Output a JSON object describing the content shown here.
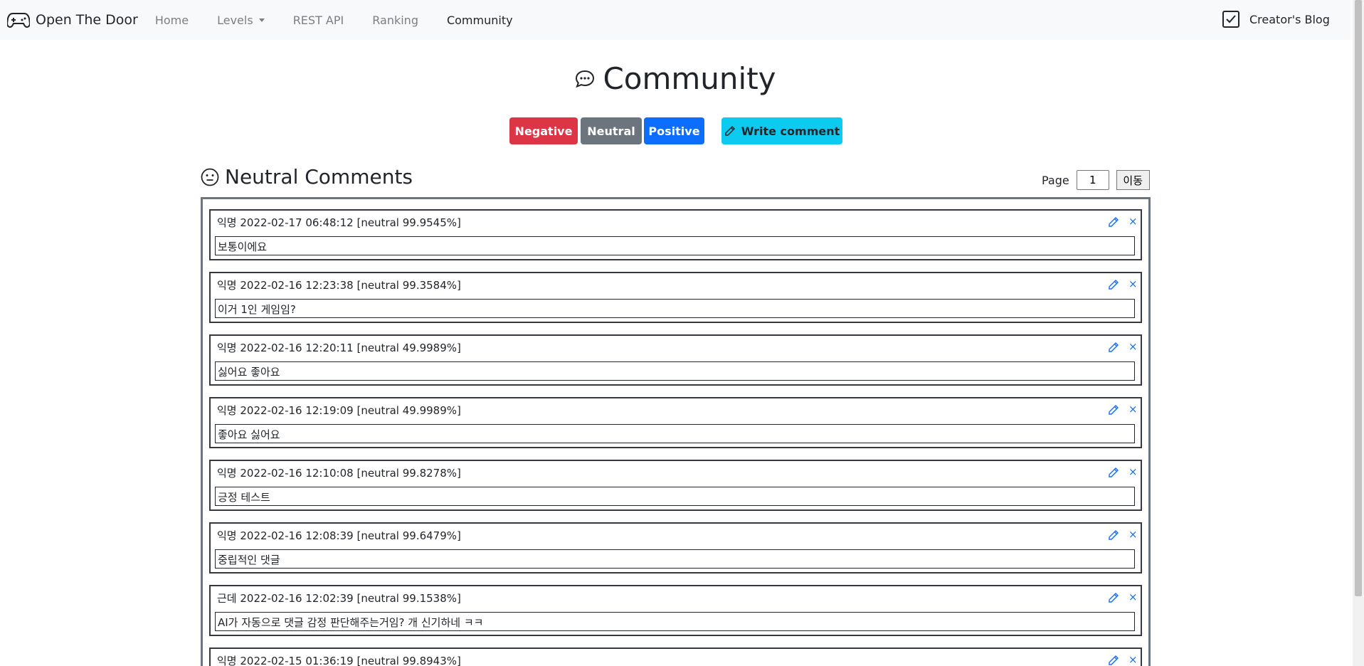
{
  "navbar": {
    "brand": "Open The Door",
    "links": [
      {
        "label": "Home",
        "active": false
      },
      {
        "label": "Levels",
        "active": false,
        "dropdown": true
      },
      {
        "label": "REST API",
        "active": false
      },
      {
        "label": "Ranking",
        "active": false
      },
      {
        "label": "Community",
        "active": true
      }
    ],
    "blog_label": "Creator's Blog"
  },
  "header": {
    "title": "Community",
    "buttons": {
      "negative": "Negative",
      "neutral": "Neutral",
      "positive": "Positive",
      "write": "Write comment"
    }
  },
  "section": {
    "title": "Neutral Comments",
    "page_label": "Page",
    "page_value": "1",
    "go_label": "이동"
  },
  "comments": [
    {
      "author": "익명",
      "stamp": "2022-02-17 06:48:12 [neutral 99.9545%]",
      "text": "보통이에요"
    },
    {
      "author": "익명",
      "stamp": "2022-02-16 12:23:38 [neutral 99.3584%]",
      "text": "이거 1인 게임임?"
    },
    {
      "author": "익명",
      "stamp": "2022-02-16 12:20:11 [neutral 49.9989%]",
      "text": "싫어요 좋아요"
    },
    {
      "author": "익명",
      "stamp": "2022-02-16 12:19:09 [neutral 49.9989%]",
      "text": "좋아요 싫어요"
    },
    {
      "author": "익명",
      "stamp": "2022-02-16 12:10:08 [neutral 99.8278%]",
      "text": "긍정 테스트"
    },
    {
      "author": "익명",
      "stamp": "2022-02-16 12:08:39 [neutral 99.6479%]",
      "text": "중립적인 댓글"
    },
    {
      "author": "근데",
      "stamp": "2022-02-16 12:02:39 [neutral 99.1538%]",
      "text": "AI가 자동으로 댓글 감정 판단해주는거임? 개 신기하네 ㅋㅋ"
    },
    {
      "author": "익명",
      "stamp": "2022-02-15 01:36:19 [neutral 99.8943%]",
      "text": ""
    }
  ],
  "colors": {
    "negative": "#dc3545",
    "neutral": "#6c757d",
    "positive": "#0d6efd",
    "write": "#0dcaf0",
    "navbar_bg": "#f8f9fa"
  },
  "icons": {
    "brand": "gamepad-icon",
    "blog": "check-square-icon",
    "title": "chat-bubble-icon",
    "section": "neutral-face-icon",
    "edit": "pencil-icon",
    "delete": "close-icon"
  }
}
